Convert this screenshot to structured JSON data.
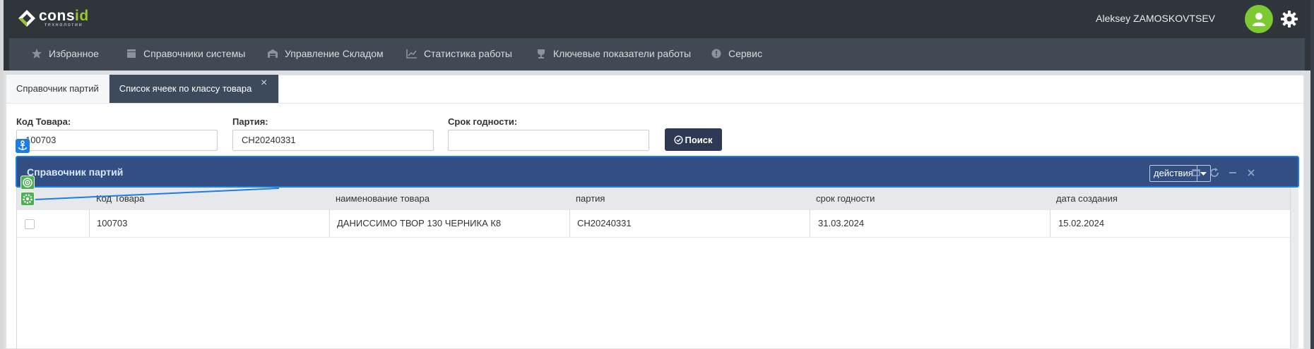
{
  "brand": {
    "name_a": "cons",
    "name_b": "id",
    "tagline": "технологии",
    "accent": "#9bc634"
  },
  "user": {
    "name": "Aleksey ZAMOSKOVTSEV"
  },
  "menu": [
    {
      "label": "Избранное",
      "icon": "star-icon"
    },
    {
      "label": "Справочники системы",
      "icon": "book-icon"
    },
    {
      "label": "Управление Складом",
      "icon": "warehouse-icon"
    },
    {
      "label": "Статистика работы",
      "icon": "chart-icon"
    },
    {
      "label": "Ключевые показатели работы",
      "icon": "trophy-icon"
    },
    {
      "label": "Сервис",
      "icon": "service-icon"
    }
  ],
  "tabs": [
    {
      "label": "Справочник партий",
      "active": false
    },
    {
      "label": "Список ячеек по классу товара",
      "active": true
    }
  ],
  "form": {
    "code_label": "Код Товара:",
    "code_value": "100703",
    "batch_label": "Партия:",
    "batch_value": "CH20240331",
    "expiry_label": "Срок годности:",
    "expiry_value": "",
    "search_label": "Поиск"
  },
  "panel": {
    "title": "Справочник партий",
    "actions_label": "действия"
  },
  "grid": {
    "columns": [
      "Код Товара",
      "наименование товара",
      "партия",
      "срок годности",
      "дата создания"
    ],
    "rows": [
      {
        "code": "100703",
        "name": "ДАНИССИМО ТВОР 130 ЧЕРНИКА К8",
        "batch": "CH20240331",
        "expiry": "31.03.2024",
        "created": "15.02.2024"
      }
    ]
  },
  "colors": {
    "header": "#2f353b",
    "menubar": "#414a54",
    "panel": "#324e82",
    "active_tab": "#3c4a5c",
    "selection": "#1e7de3",
    "avatar": "#7cc932"
  }
}
